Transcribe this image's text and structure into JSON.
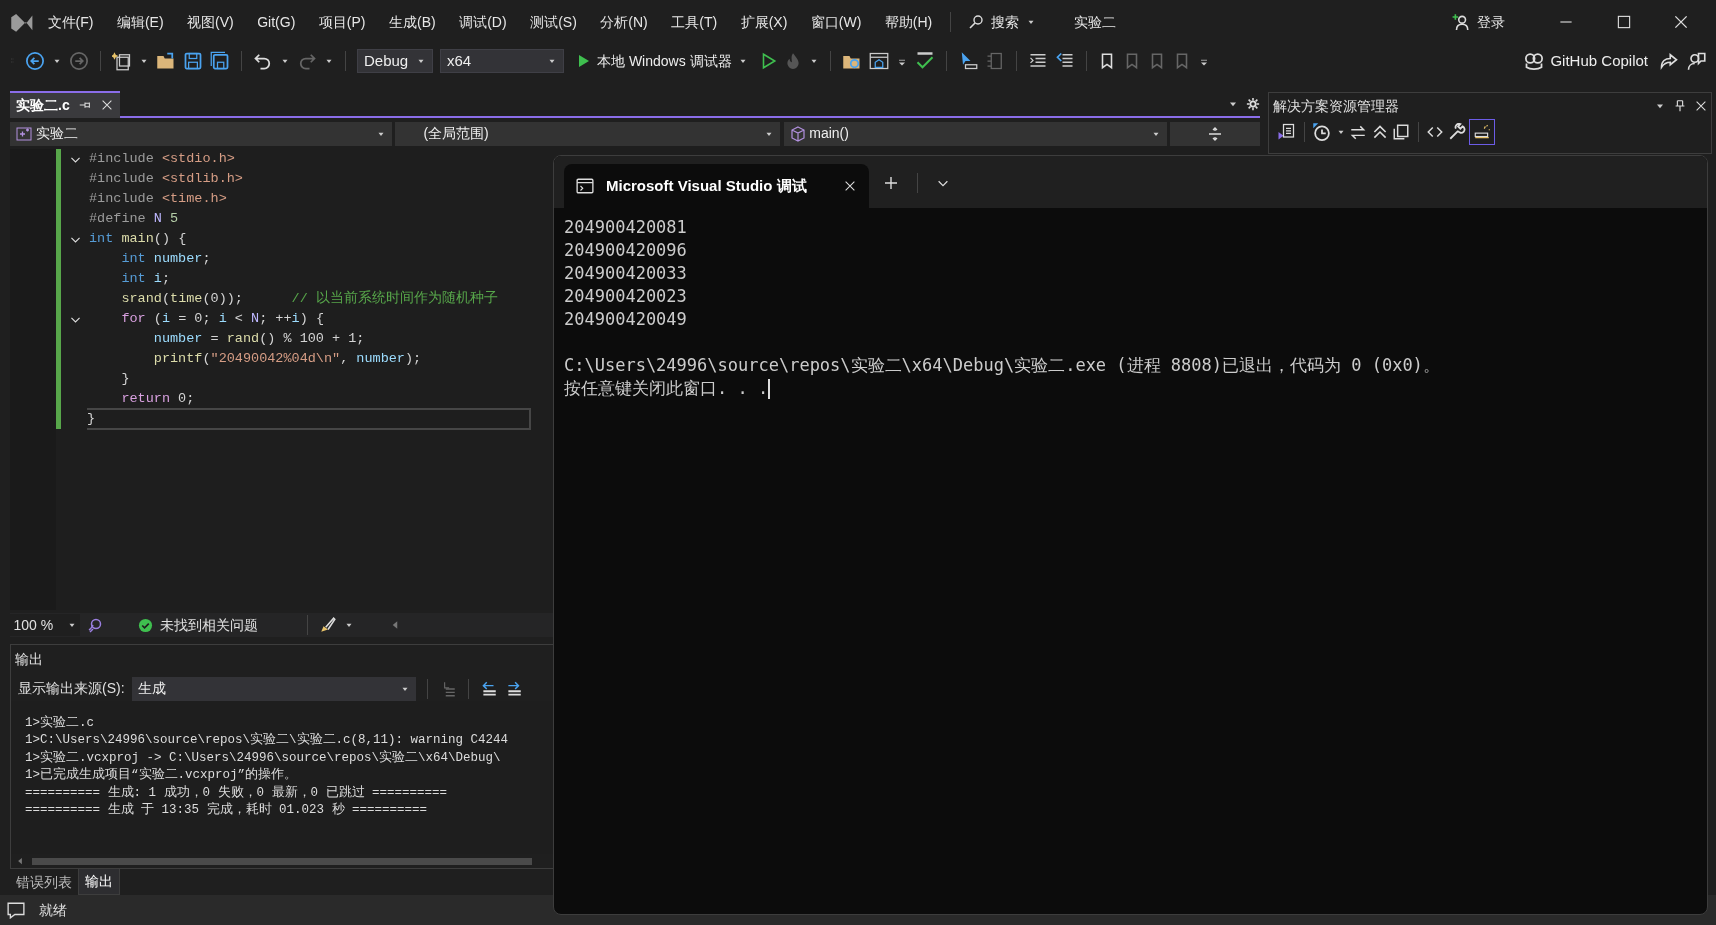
{
  "menu_bar": {
    "menus": [
      "文件(F)",
      "编辑(E)",
      "视图(V)",
      "Git(G)",
      "项目(P)",
      "生成(B)",
      "调试(D)",
      "测试(S)",
      "分析(N)",
      "工具(T)",
      "扩展(X)",
      "窗口(W)",
      "帮助(H)"
    ],
    "search": "搜索",
    "solution_name": "实验二",
    "sign_in": "登录"
  },
  "toolbar": {
    "configuration": "Debug",
    "platform": "x64",
    "run_target": "本地 Windows 调试器",
    "copilot": "GitHub Copilot"
  },
  "editor": {
    "tabs": [
      {
        "label": "实验二.c",
        "selected": true
      }
    ],
    "project": "实验二",
    "scope": "(全局范围)",
    "member": "main()",
    "lines": [
      {
        "foldable": true,
        "current": false,
        "tokens": [
          {
            "text": "#include ",
            "kind": "pp"
          },
          {
            "text": "<stdio.h>",
            "kind": "str"
          }
        ]
      },
      {
        "foldable": false,
        "current": false,
        "tokens": [
          {
            "text": "#include ",
            "kind": "pp"
          },
          {
            "text": "<stdlib.h>",
            "kind": "str"
          }
        ]
      },
      {
        "foldable": false,
        "current": false,
        "tokens": [
          {
            "text": "#include ",
            "kind": "pp"
          },
          {
            "text": "<time.h>",
            "kind": "str"
          }
        ]
      },
      {
        "foldable": false,
        "current": false,
        "tokens": [
          {
            "text": "#define ",
            "kind": "pp"
          },
          {
            "text": "N",
            "kind": "macro"
          },
          {
            "text": " 5",
            "kind": "num"
          }
        ]
      },
      {
        "foldable": true,
        "current": false,
        "tokens": [
          {
            "text": "int",
            "kind": "kw"
          },
          {
            "text": " main",
            "kind": "fn"
          },
          {
            "text": "() {",
            "kind": "p"
          }
        ]
      },
      {
        "foldable": false,
        "current": false,
        "tokens": [
          {
            "text": "    int",
            "kind": "kw"
          },
          {
            "text": " number",
            "kind": "var"
          },
          {
            "text": ";",
            "kind": "p"
          }
        ]
      },
      {
        "foldable": false,
        "current": false,
        "tokens": [
          {
            "text": "    int",
            "kind": "kw"
          },
          {
            "text": " i",
            "kind": "var"
          },
          {
            "text": ";",
            "kind": "p"
          }
        ]
      },
      {
        "foldable": false,
        "current": false,
        "tokens": [
          {
            "text": "    srand",
            "kind": "fn"
          },
          {
            "text": "(",
            "kind": "p"
          },
          {
            "text": "time",
            "kind": "fn"
          },
          {
            "text": "(0));",
            "kind": "p"
          },
          {
            "text": "      // 以当前系统时间作为随机种子",
            "kind": "cm"
          }
        ]
      },
      {
        "foldable": true,
        "current": false,
        "tokens": [
          {
            "text": "    for",
            "kind": "ctl"
          },
          {
            "text": " (",
            "kind": "p"
          },
          {
            "text": "i",
            "kind": "var"
          },
          {
            "text": " = 0; ",
            "kind": "p"
          },
          {
            "text": "i",
            "kind": "var"
          },
          {
            "text": " < ",
            "kind": "p"
          },
          {
            "text": "N",
            "kind": "macro"
          },
          {
            "text": "; ++",
            "kind": "p"
          },
          {
            "text": "i",
            "kind": "var"
          },
          {
            "text": ") {",
            "kind": "p"
          }
        ]
      },
      {
        "foldable": false,
        "current": false,
        "tokens": [
          {
            "text": "        number",
            "kind": "var"
          },
          {
            "text": " = ",
            "kind": "p"
          },
          {
            "text": "rand",
            "kind": "fn"
          },
          {
            "text": "() % 100 + 1;",
            "kind": "p"
          }
        ]
      },
      {
        "foldable": false,
        "current": false,
        "tokens": [
          {
            "text": "        printf",
            "kind": "fn"
          },
          {
            "text": "(",
            "kind": "p"
          },
          {
            "text": "\"20490042%04d\\n\"",
            "kind": "str"
          },
          {
            "text": ", ",
            "kind": "p"
          },
          {
            "text": "number",
            "kind": "var"
          },
          {
            "text": ");",
            "kind": "p"
          }
        ]
      },
      {
        "foldable": false,
        "current": false,
        "tokens": [
          {
            "text": "    }",
            "kind": "p"
          }
        ]
      },
      {
        "foldable": false,
        "current": false,
        "tokens": [
          {
            "text": "    return",
            "kind": "ctl"
          },
          {
            "text": " 0;",
            "kind": "p"
          }
        ]
      },
      {
        "foldable": false,
        "current": true,
        "tokens": [
          {
            "text": "}",
            "kind": "p"
          }
        ]
      }
    ],
    "zoom": "100 %",
    "issues": "未找到相关问题"
  },
  "solution_explorer": {
    "title": "解决方案资源管理器"
  },
  "output": {
    "title": "输出",
    "source_label": "显示输出来源(S):",
    "source": "生成",
    "lines": [
      "1>实验二.c",
      "1>C:\\Users\\24996\\source\\repos\\实验二\\实验二.c(8,11): warning C4244",
      "1>实验二.vcxproj -> C:\\Users\\24996\\source\\repos\\实验二\\x64\\Debug\\",
      "1>已完成生成项目“实验二.vcxproj”的操作。",
      "========== 生成: 1 成功，0 失败，0 最新，0 已跳过 ==========",
      "========== 生成 于 13:35 完成，耗时 01.023 秒 =========="
    ]
  },
  "bottom_tabs": [
    {
      "label": "错误列表",
      "selected": false
    },
    {
      "label": "输出",
      "selected": true
    }
  ],
  "status_bar": {
    "text": "就绪"
  },
  "console": {
    "tab_title": "Microsoft Visual Studio 调试",
    "numbers": [
      "204900420081",
      "204900420096",
      "204900420033",
      "204900420023",
      "204900420049"
    ],
    "messages": [
      "C:\\Users\\24996\\source\\repos\\实验二\\x64\\Debug\\实验二.exe (进程 8808)已退出，代码为 0 (0x0)。",
      "按任意键关闭此窗口. . ."
    ]
  }
}
